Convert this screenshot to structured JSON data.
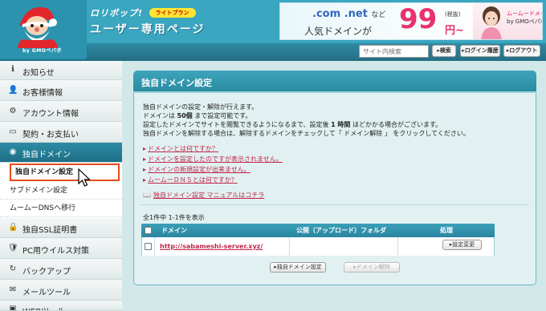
{
  "header": {
    "brand_name": "ロリポップ!",
    "plan_badge": "ライトプラン",
    "brand_subtitle": "ユーザー専用ページ",
    "logo_sub": "by GMOペパボ"
  },
  "banner": {
    "line1_main": ".com .net",
    "line1_small": "など",
    "line2": "人気ドメインが",
    "price": "99",
    "taxed": "(税抜)",
    "yen": "円~",
    "right_line1": "ムームードメイン",
    "right_line2": "by GMOペパボ"
  },
  "toolbar": {
    "search_placeholder": "サイト内検索",
    "search_btn": "▸検索",
    "login_history_btn": "▸ログイン履歴",
    "logout_btn": "▸ログアウト"
  },
  "sidebar": {
    "items": [
      {
        "icon": "ℹ",
        "label": "お知らせ"
      },
      {
        "icon": "👤",
        "label": "お客様情報"
      },
      {
        "icon": "⚙",
        "label": "アカウント情報"
      },
      {
        "icon": "▭",
        "label": "契約・お支払い"
      },
      {
        "icon": "◉",
        "label": "独自ドメイン"
      }
    ],
    "sub_items": [
      {
        "label": "独自ドメイン設定"
      },
      {
        "label": "サブドメイン設定"
      },
      {
        "label": "ムームーDNSへ移行"
      }
    ],
    "items2": [
      {
        "icon": "🔒",
        "label": "独自SSL証明書"
      },
      {
        "icon": "🛡",
        "label": "PC用ウイルス対策"
      },
      {
        "icon": "↻",
        "label": "バックアップ"
      },
      {
        "icon": "✉",
        "label": "メールツール"
      },
      {
        "icon": "▣",
        "label": "WEBツール"
      }
    ]
  },
  "main": {
    "title": "独自ドメイン設定",
    "desc1": "独自ドメインの設定・解除が行えます。",
    "desc2_a": "ドメインは ",
    "desc2_b": "50個",
    "desc2_c": " まで設定可能です。",
    "desc3_a": "設定したドメインでサイトを閲覧できるようになるまで、設定後 ",
    "desc3_b": "1 時間",
    "desc3_c": " ほどかかる場合がございます。",
    "desc4": "独自ドメインを解除する場合は、解除するドメインをチェックして「 ドメイン解除 」 をクリックしてください。",
    "links": [
      "ドメインとは何ですか？",
      "ドメインを設定したのですが表示されません。",
      "ドメインの新規設定が出来ません。",
      "ムームーＤＮＳとは何ですか？"
    ],
    "manual_link": "独自ドメイン設定 マニュアルはコチラ",
    "count": "全1件中 1-1件を表示",
    "table": {
      "headers": [
        "ドメイン",
        "公開（アップロード）フォルダ",
        "処理"
      ],
      "rows": [
        {
          "domain": "http://sabameshi-server.xyz/",
          "folder": "",
          "action": "▸設定変更"
        }
      ]
    },
    "add_btn": "▸独自ドメイン設定",
    "remove_btn": "▸ドメイン解除"
  }
}
